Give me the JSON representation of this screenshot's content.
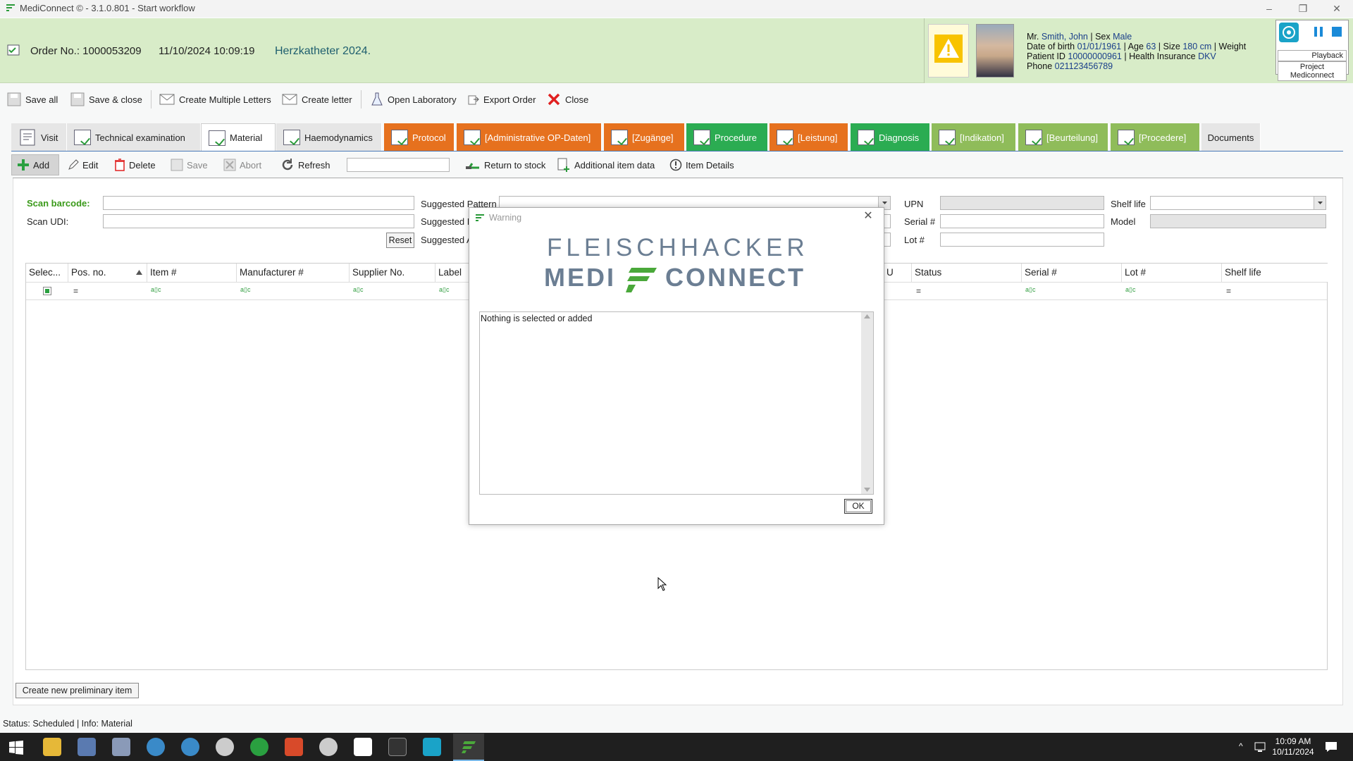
{
  "window": {
    "title": "MediConnect © - 3.1.0.801 - Start workflow"
  },
  "header": {
    "order_label": "Order No.: 1000053209",
    "datetime": "11/10/2024 10:09:19",
    "procedure": "Herzkatheter 2024."
  },
  "patient": {
    "salutation": "Mr.",
    "name": "Smith, John",
    "sex_label": "| Sex",
    "sex": "Male",
    "dob_label": "Date of birth",
    "dob": "01/01/1961",
    "age_label": "| Age",
    "age": "63",
    "size_label": "| Size",
    "size": "180 cm",
    "weight_label": "| Weight",
    "pid_label": "Patient ID",
    "pid": "10000000961",
    "insurance_label": "| Health Insurance",
    "insurance": "DKV",
    "phone_label": "Phone",
    "phone": "021123456789",
    "playback": "Playback",
    "project": "Project Mediconnect"
  },
  "toolbar": {
    "save_all": "Save all",
    "save_close": "Save & close",
    "create_multiple": "Create Multiple Letters",
    "create_letter": "Create letter",
    "open_lab": "Open Laboratory",
    "export_order": "Export Order",
    "close": "Close"
  },
  "tabs": [
    {
      "label": "Visit"
    },
    {
      "label": "Technical examination"
    },
    {
      "label": "Material"
    },
    {
      "label": "Haemodynamics"
    },
    {
      "label": "Protocol"
    },
    {
      "label": "[Administrative OP-Daten]"
    },
    {
      "label": "[Zugänge]"
    },
    {
      "label": "Procedure"
    },
    {
      "label": "[Leistung]"
    },
    {
      "label": "Diagnosis"
    },
    {
      "label": "[Indikation]"
    },
    {
      "label": "[Beurteilung]"
    },
    {
      "label": "[Procedere]"
    },
    {
      "label": "Documents"
    }
  ],
  "material_toolbar": {
    "add": "Add",
    "edit": "Edit",
    "delete": "Delete",
    "save": "Save",
    "abort": "Abort",
    "refresh": "Refresh",
    "return_stock": "Return to stock",
    "additional": "Additional item data",
    "item_details": "Item Details"
  },
  "form": {
    "scan_barcode": "Scan barcode:",
    "scan_udi": "Scan UDI:",
    "reset": "Reset",
    "suggested_pattern": "Suggested Pattern",
    "suggested_i": "Suggested I",
    "suggested_a": "Suggested A",
    "upn": "UPN",
    "serial": "Serial #",
    "lot": "Lot #",
    "shelf_life": "Shelf life",
    "model": "Model"
  },
  "grid": {
    "columns": [
      "Selec...",
      "Pos. no.",
      "Item #",
      "Manufacturer #",
      "Supplier No.",
      "Label",
      "U",
      "Status",
      "Serial #",
      "Lot #",
      "Shelf life"
    ],
    "filter_eq": "=",
    "filter_abc": "a▯c"
  },
  "create_item": "Create new preliminary item",
  "dialog": {
    "title": "Warning",
    "brand_top": "FLEISCHHACKER",
    "brand_left": "MEDI",
    "brand_right": "CONNECT",
    "message": "Nothing is selected or added",
    "ok": "OK"
  },
  "status": {
    "text": "Status: Scheduled",
    "info": "Info: Material"
  },
  "taskbar": {
    "time": "10:09 AM",
    "date": "10/11/2024"
  },
  "colors": {
    "orange_tab": "#e6711e",
    "green_tab": "#2bac52",
    "light_green_tab": "#8fbc5a",
    "header_bg": "#d8ecc8"
  }
}
